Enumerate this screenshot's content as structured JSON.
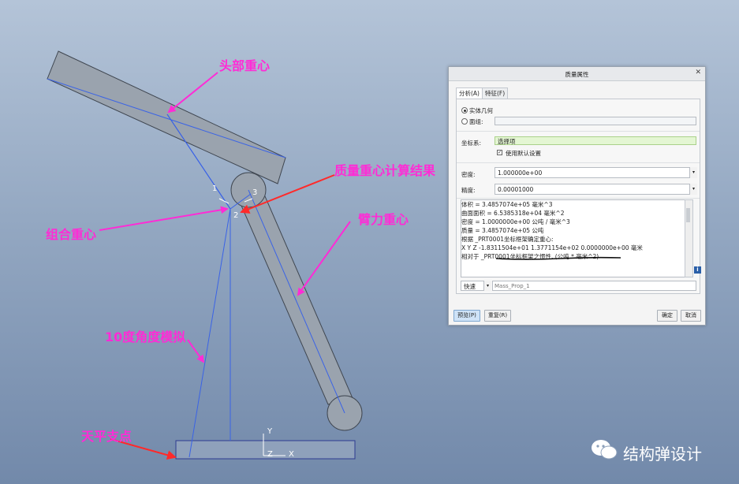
{
  "annotations": {
    "head_cog": "头部重心",
    "mass_cog_result": "质量重心计算结果",
    "combined_cog": "组合重心",
    "arm_cog": "臂力重心",
    "angle_sim": "10度角度模拟",
    "balance_pivot": "天平支点"
  },
  "point_labels": {
    "p1": "1",
    "p2": "2",
    "p3": "3"
  },
  "axis_labels": {
    "y": "Y",
    "z": "Z",
    "x": "X"
  },
  "dialog": {
    "title": "质量属性",
    "tabs": [
      "分析(A)",
      "特征(F)"
    ],
    "radio_solid": "实体几何",
    "radio_quilt": "面组:",
    "csys_label": "坐标系:",
    "csys_value": "选择项",
    "use_default": "使用默认设置",
    "density_label": "密度:",
    "density_value": "1.000000e+00",
    "accuracy_label": "精度:",
    "accuracy_value": "0.00001000",
    "results": [
      "体积 =   3.4857074e+05  毫米^3",
      "曲面面积 =  6.5385318e+04  毫米^2",
      "密度 =   1.0000000e+00 公吨 / 毫米^3",
      "质量 =   3.4857074e+05 公吨",
      "",
      "根据 _PRT0001坐标框架确定重心:",
      "X  Y  Z    -1.8311504e+01  1.3771154e+02  0.0000000e+00  毫米",
      "",
      "相对于 _PRT0001坐标框架之惯性. (公吨 * 毫米^2)"
    ],
    "mode_value": "快速",
    "name_placeholder": "Mass_Prop_1",
    "btn_preview": "预览(P)",
    "btn_repeat": "重复(R)",
    "btn_ok": "确定",
    "btn_cancel": "取消"
  },
  "brand": {
    "name": "结构弹设计",
    "icon": "wechat-icon"
  },
  "colors": {
    "accent": "#ff2bd6",
    "arrow_red": "#ff2a2a",
    "line_blue": "#3a63e6"
  }
}
